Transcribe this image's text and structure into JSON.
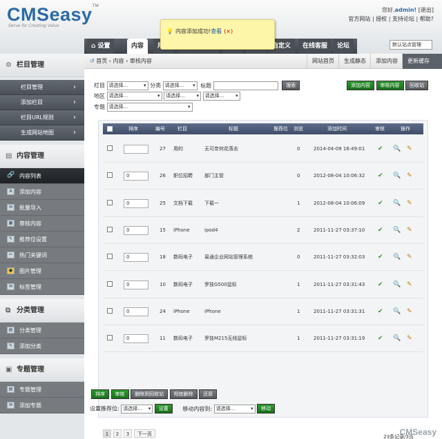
{
  "app": {
    "logo": "CMSeasy",
    "logo_tm": "TM",
    "slogan": "Serve for Creating Value",
    "footer_logo": "CMSeasy"
  },
  "userbar": {
    "greeting": "您好,",
    "user": "admin!",
    "logout": "[退出]",
    "links": [
      "官方网站",
      "授权",
      "支持论坛",
      "帮助?"
    ]
  },
  "toast": {
    "message": "内容添加成功!",
    "view": "查看",
    "close": "(×)"
  },
  "nav": {
    "tabs": [
      "设置",
      "内容",
      "用户",
      "模版",
      "功能",
      "模板",
      "营销",
      "自定义",
      "在线客服",
      "论坛"
    ],
    "active": 1,
    "site_select": "默认站点管理"
  },
  "sidebar": {
    "section1": "栏目管理",
    "section1_items": [
      "栏目管理",
      "添加栏目",
      "栏目URL规则",
      "生成网站地图"
    ],
    "section2": "内容管理",
    "section2_items": [
      "内容列表",
      "添加内容",
      "批量导入",
      "审核内容",
      "推荐位设置",
      "热门关键词",
      "图片管理",
      "标签管理"
    ],
    "section3": "分类管理",
    "section3_items": [
      "分类管理",
      "添加分类"
    ],
    "section4": "专题管理",
    "section4_items": [
      "专题管理",
      "添加专题"
    ]
  },
  "crumb": {
    "home": "首页",
    "sep": "›",
    "parts": [
      "内容",
      "审核内容"
    ],
    "actions": [
      "网站首页",
      "生成静态",
      "添加内容",
      "更新缓存"
    ]
  },
  "filter": {
    "column_label": "栏目",
    "category_label": "分类",
    "title_label": "标题",
    "region_label": "地区",
    "topic_label": "专题",
    "placeholder": "请选择...",
    "search_btn": "搜索",
    "btn_add": "添加内容",
    "btn_audit": "审核内容",
    "btn_recycle": "回收站"
  },
  "table": {
    "headers": [
      "排序",
      "编号",
      "栏目",
      "标题",
      "推荐位",
      "浏览",
      "添加时间",
      "审核",
      "操作"
    ],
    "rows": [
      {
        "order": "",
        "id": "27",
        "column": "用的",
        "title": "无可奈何花落去",
        "views": "0",
        "time": "2014-04-09 16:49:01"
      },
      {
        "order": "0",
        "id": "26",
        "column": "职位招聘",
        "title": "部门主管",
        "views": "0",
        "time": "2012-08-04 10:06:32"
      },
      {
        "order": "0",
        "id": "25",
        "column": "文档下载",
        "title": "下载一",
        "views": "1",
        "time": "2012-08-04 10:06:09"
      },
      {
        "order": "0",
        "id": "15",
        "column": "iPhone",
        "title": "ipod4",
        "views": "2",
        "time": "2011-11-27 03:37:10"
      },
      {
        "order": "0",
        "id": "18",
        "column": "数码电子",
        "title": "易通企业网站管理系统",
        "views": "0",
        "time": "2011-11-27 03:32:03"
      },
      {
        "order": "0",
        "id": "10",
        "column": "数码电子",
        "title": "罗技G500鼠标",
        "views": "1",
        "time": "2011-11-27 03:31:43"
      },
      {
        "order": "0",
        "id": "24",
        "column": "iPhone",
        "title": "iPhone",
        "views": "1",
        "time": "2011-11-27 03:31:31"
      },
      {
        "order": "0",
        "id": "11",
        "column": "数码电子",
        "title": "罗技M215无线鼠标",
        "views": "1",
        "time": "2011-11-27 03:31:19"
      }
    ],
    "audit_icon": "✔",
    "view_icon": "🔍",
    "edit_icon": "✎"
  },
  "pager": {
    "pages": [
      "1",
      "2",
      "3"
    ],
    "next": "下一页",
    "count": "23条记录/3页"
  },
  "batch": {
    "sort": "排序",
    "audit": "审核",
    "to_recycle": "删除到回收站",
    "delete": "彻底删除",
    "restore": "还原",
    "set_rec_label": "设置推荐位:",
    "set_btn": "设置",
    "move_label": "移动内容到:",
    "move_btn": "移动"
  }
}
